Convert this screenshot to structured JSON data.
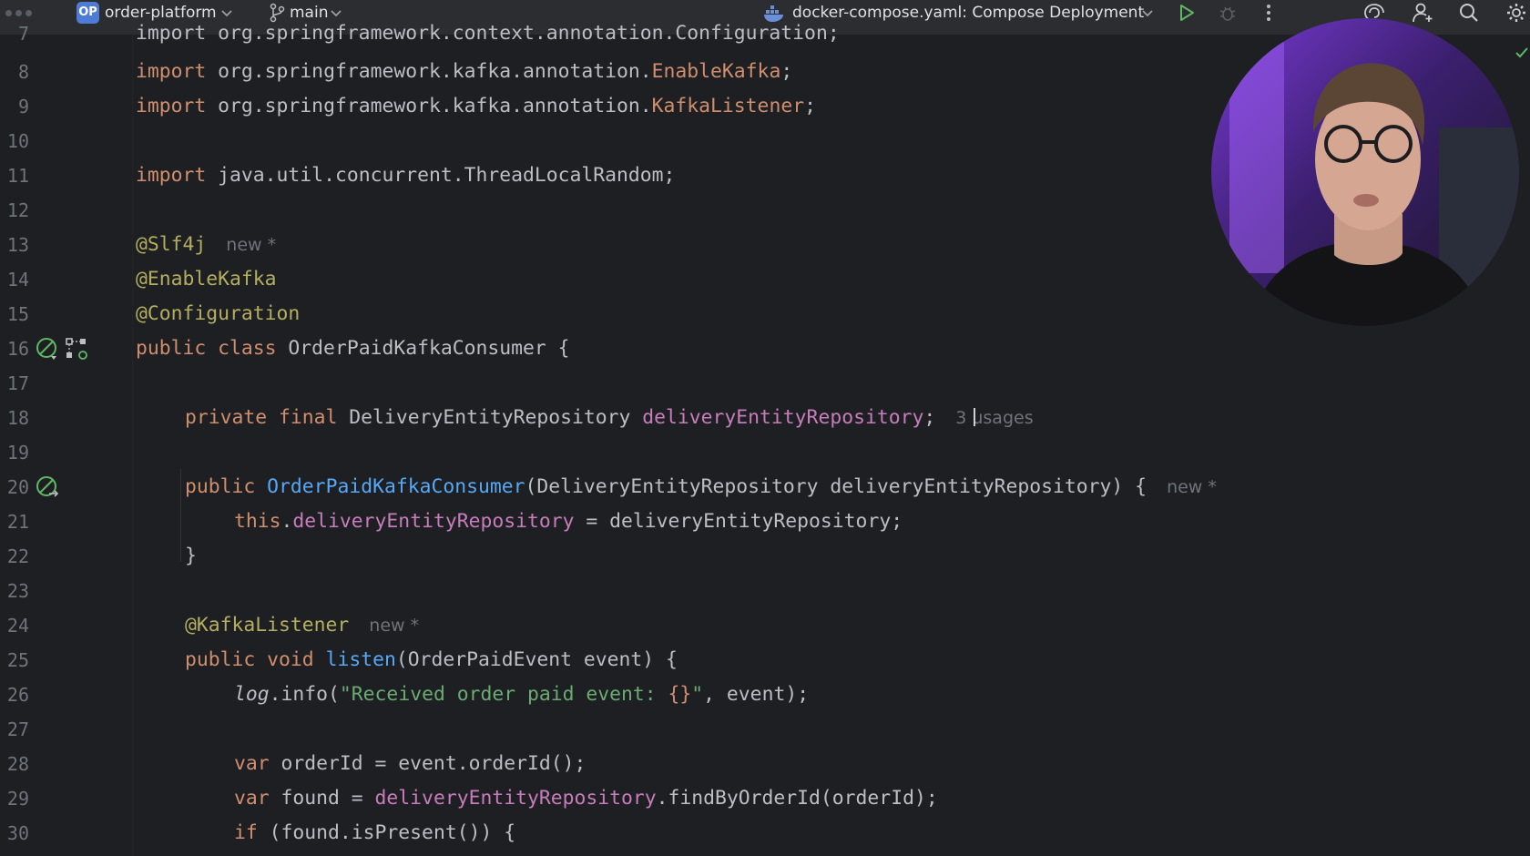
{
  "toolbar": {
    "project_badge": "OP",
    "project_name": "order-platform",
    "branch_name": "main",
    "run_config": "docker-compose.yaml: Compose Deployment",
    "icons": [
      "menu-dots-icon",
      "chevron-down-icon",
      "git-branch-icon",
      "docker-icon",
      "run-icon",
      "debug-icon",
      "more-vertical-icon",
      "ai-assistant-icon",
      "add-user-icon",
      "search-icon",
      "settings-icon"
    ]
  },
  "editor": {
    "first_line_text": "import org.springframework.context.annotation.Configuration;",
    "lines": [
      {
        "n": "7"
      },
      {
        "n": "8"
      },
      {
        "n": "9"
      },
      {
        "n": "10"
      },
      {
        "n": "11"
      },
      {
        "n": "12"
      },
      {
        "n": "13"
      },
      {
        "n": "14"
      },
      {
        "n": "15"
      },
      {
        "n": "16"
      },
      {
        "n": "17"
      },
      {
        "n": "18"
      },
      {
        "n": "19"
      },
      {
        "n": "20"
      },
      {
        "n": "21"
      },
      {
        "n": "22"
      },
      {
        "n": "23"
      },
      {
        "n": "24"
      },
      {
        "n": "25"
      },
      {
        "n": "26"
      },
      {
        "n": "27"
      },
      {
        "n": "28"
      },
      {
        "n": "29"
      },
      {
        "n": "30"
      }
    ],
    "code": {
      "l8": {
        "kw": "import",
        "pkg": " org.springframework.kafka.annotation.",
        "cls": "EnableKafka",
        "end": ";"
      },
      "l9": {
        "kw": "import",
        "pkg": " org.springframework.kafka.annotation.",
        "cls": "KafkaListener",
        "end": ";"
      },
      "l11": {
        "kw": "import",
        "rest": " java.util.concurrent.ThreadLocalRandom;"
      },
      "l13": {
        "ann": "@Slf4j",
        "hint": "new *"
      },
      "l14": {
        "ann": "@EnableKafka"
      },
      "l15": {
        "ann": "@Configuration"
      },
      "l16": {
        "kw": "public class",
        "name": " OrderPaidKafkaConsumer {"
      },
      "l18": {
        "kw": "private final",
        "type": " DeliveryEntityRepository ",
        "field": "deliveryEntityRepository",
        "end": ";",
        "hint": "3 usages"
      },
      "l20": {
        "kw": "public",
        "ctor": "OrderPaidKafkaConsumer",
        "params": "(DeliveryEntityRepository deliveryEntityRepository) {",
        "hint": "new *"
      },
      "l21": {
        "kw": "this",
        "dot": ".",
        "field": "deliveryEntityRepository",
        "rest": " = deliveryEntityRepository;"
      },
      "l22": {
        "text": "}"
      },
      "l24": {
        "ann": "@KafkaListener",
        "hint": "new *"
      },
      "l25": {
        "kw": "public void",
        "fn": "listen",
        "rest": "(OrderPaidEvent event) {"
      },
      "l26": {
        "log": "log",
        "call": ".info(",
        "str": "\"Received order paid event: ",
        "brace": "{}",
        "str_end": "\"",
        "rest": ", event);"
      },
      "l28": {
        "kw": "var",
        "rest": " orderId = event.orderId();"
      },
      "l29": {
        "kw": "var",
        "mid": " found = ",
        "field": "deliveryEntityRepository",
        "rest": ".findByOrderId(orderId);"
      },
      "l30": {
        "kw": "if",
        "rest": " (found.isPresent()) {"
      }
    }
  },
  "colors": {
    "background": "#1e1f22",
    "toolbar": "#2b2d30",
    "keyword": "#cf8e6d",
    "annotation": "#b3ae60",
    "field": "#c77dbb",
    "function": "#56a8f5",
    "string": "#6aab73",
    "line_number": "#6f737a"
  },
  "overlay": {
    "webcam_present": true
  }
}
